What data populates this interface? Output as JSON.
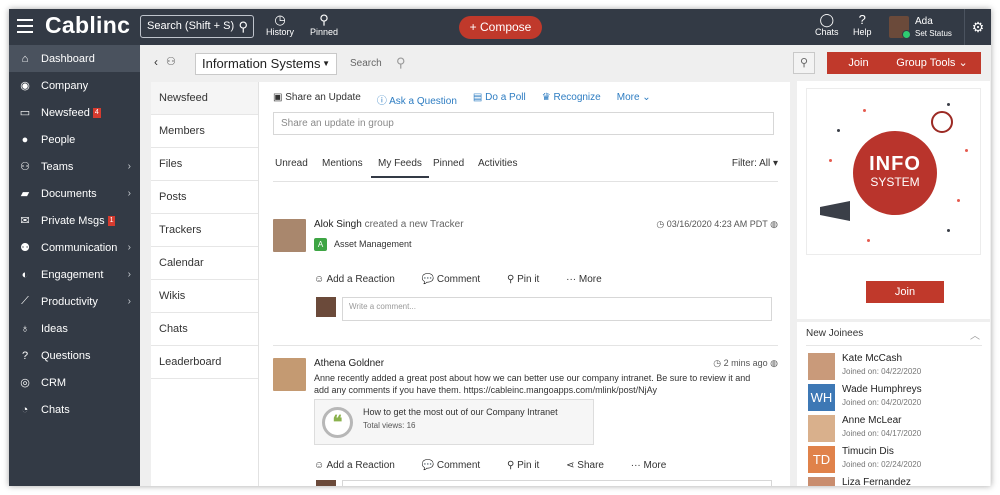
{
  "app": {
    "logo": "Cablinc",
    "search_label": "Search (Shift + S)",
    "history": "History",
    "pinned": "Pinned",
    "compose": "+ Compose",
    "chats": "Chats",
    "help": "Help",
    "user_name": "Ada",
    "user_status": "Set Status"
  },
  "sidebar": {
    "items": [
      {
        "label": "Dashboard",
        "icon": "home-icon",
        "glyph": "⌂"
      },
      {
        "label": "Company",
        "icon": "globe-icon",
        "glyph": "◉"
      },
      {
        "label": "Newsfeed",
        "icon": "inbox-icon",
        "glyph": "▭",
        "badge": "4"
      },
      {
        "label": "People",
        "icon": "person-icon",
        "glyph": "●"
      },
      {
        "label": "Teams",
        "icon": "team-icon",
        "glyph": "⚇"
      },
      {
        "label": "Documents",
        "icon": "folder-icon",
        "glyph": "▰"
      },
      {
        "label": "Private Msgs",
        "icon": "mail-icon",
        "glyph": "✉",
        "badge": "1"
      },
      {
        "label": "Communication",
        "icon": "group-icon",
        "glyph": "⚉"
      },
      {
        "label": "Engagement",
        "icon": "gamepad-icon",
        "glyph": "◐"
      },
      {
        "label": "Productivity",
        "icon": "chart-icon",
        "glyph": "⟋"
      },
      {
        "label": "Ideas",
        "icon": "bulb-icon",
        "glyph": "♁"
      },
      {
        "label": "Questions",
        "icon": "question-icon",
        "glyph": "?"
      },
      {
        "label": "CRM",
        "icon": "target-icon",
        "glyph": "◎"
      },
      {
        "label": "Chats",
        "icon": "chat-icon",
        "glyph": "◔"
      }
    ]
  },
  "group": {
    "name": "Information Systems",
    "search_label": "Search",
    "nav": [
      "Newsfeed",
      "Members",
      "Files",
      "Posts",
      "Trackers",
      "Calendar",
      "Wikis",
      "Chats",
      "Leaderboard"
    ]
  },
  "feed": {
    "actions": [
      "Share an Update",
      "Ask a Question",
      "Do a Poll",
      "Recognize",
      "More"
    ],
    "share_placeholder": "Share an update in group",
    "tabs": [
      "Unread",
      "Mentions",
      "My Feeds",
      "Pinned",
      "Activities"
    ],
    "filter_label": "Filter: All",
    "comment_placeholder": "Write a comment...",
    "posts": [
      {
        "author": "Alok Singh",
        "verb": "created a new Tracker",
        "time": "03/16/2020 4:23 AM PDT",
        "tracker": "Asset Management",
        "reactions": [
          "Add a Reaction",
          "Comment",
          "Pin it",
          "More"
        ]
      },
      {
        "author": "Athena Goldner",
        "time": "2 mins ago",
        "text": "Anne recently added a great post about how we can better use our company intranet. Be sure to review it and add any comments if you have them. https://cableinc.mangoapps.com/mlink/post/NjAy",
        "link_title": "How to get the most out of our Company Intranet",
        "link_views": "Total views: 16",
        "reactions": [
          "Add a Reaction",
          "Comment",
          "Pin it",
          "Share",
          "More"
        ]
      }
    ]
  },
  "right": {
    "join": "Join",
    "group_tools": "Group Tools",
    "info_title": "INFO",
    "info_sub": "SYSTEM",
    "new_joinees": "New Joinees",
    "joinees": [
      {
        "name": "Kate McCash",
        "date": "Joined on: 04/22/2020",
        "initials": "",
        "color": "#c99a7a"
      },
      {
        "name": "Wade Humphreys",
        "date": "Joined on: 04/20/2020",
        "initials": "WH",
        "color": "#3d78b5"
      },
      {
        "name": "Anne McLear",
        "date": "Joined on: 04/17/2020",
        "initials": "",
        "color": "#d9b08c"
      },
      {
        "name": "Timucin Dis",
        "date": "Joined on: 02/24/2020",
        "initials": "TD",
        "color": "#e0824a"
      },
      {
        "name": "Liza Fernandez",
        "date": "",
        "initials": "",
        "color": "#c98d6e"
      }
    ]
  },
  "colors": {
    "accent": "#c0392b",
    "sidebar": "#333a45",
    "link": "#2e7dc2"
  }
}
